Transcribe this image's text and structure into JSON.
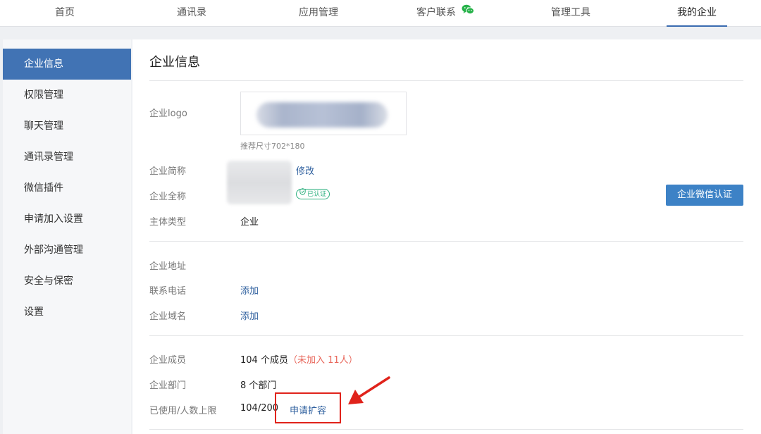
{
  "nav": {
    "tabs": [
      {
        "label": "首页"
      },
      {
        "label": "通讯录"
      },
      {
        "label": "应用管理"
      },
      {
        "label": "客户联系"
      },
      {
        "label": "管理工具"
      },
      {
        "label": "我的企业"
      }
    ],
    "active_tab": "我的企业"
  },
  "sidebar": {
    "items": [
      {
        "label": "企业信息"
      },
      {
        "label": "权限管理"
      },
      {
        "label": "聊天管理"
      },
      {
        "label": "通讯录管理"
      },
      {
        "label": "微信插件"
      },
      {
        "label": "申请加入设置"
      },
      {
        "label": "外部沟通管理"
      },
      {
        "label": "安全与保密"
      },
      {
        "label": "设置"
      }
    ],
    "active_item": "企业信息"
  },
  "main": {
    "title": "企业信息",
    "logo": {
      "label": "企业logo",
      "hint": "推荐尺寸702*180"
    },
    "short_name": {
      "label": "企业简称",
      "action": "修改"
    },
    "full_name": {
      "label": "企业全称",
      "badge": "已认证"
    },
    "entity_type": {
      "label": "主体类型",
      "value": "企业"
    },
    "verify_button": "企业微信认证",
    "address": {
      "label": "企业地址"
    },
    "phone": {
      "label": "联系电话",
      "action": "添加"
    },
    "domain": {
      "label": "企业域名",
      "action": "添加"
    },
    "members": {
      "label": "企业成员",
      "value": "104 个成员",
      "pending": "（未加入 11人）"
    },
    "departments": {
      "label": "企业部门",
      "value": "8 个部门"
    },
    "limit": {
      "label": "已使用/人数上限",
      "value": "104/200",
      "action": "申请扩容"
    }
  },
  "colors": {
    "accent": "#4173b4",
    "link": "#2e5f9e",
    "button": "#3d82c6",
    "verified": "#2cb07f",
    "warning": "#e8665a",
    "annotation": "#e0231b"
  }
}
